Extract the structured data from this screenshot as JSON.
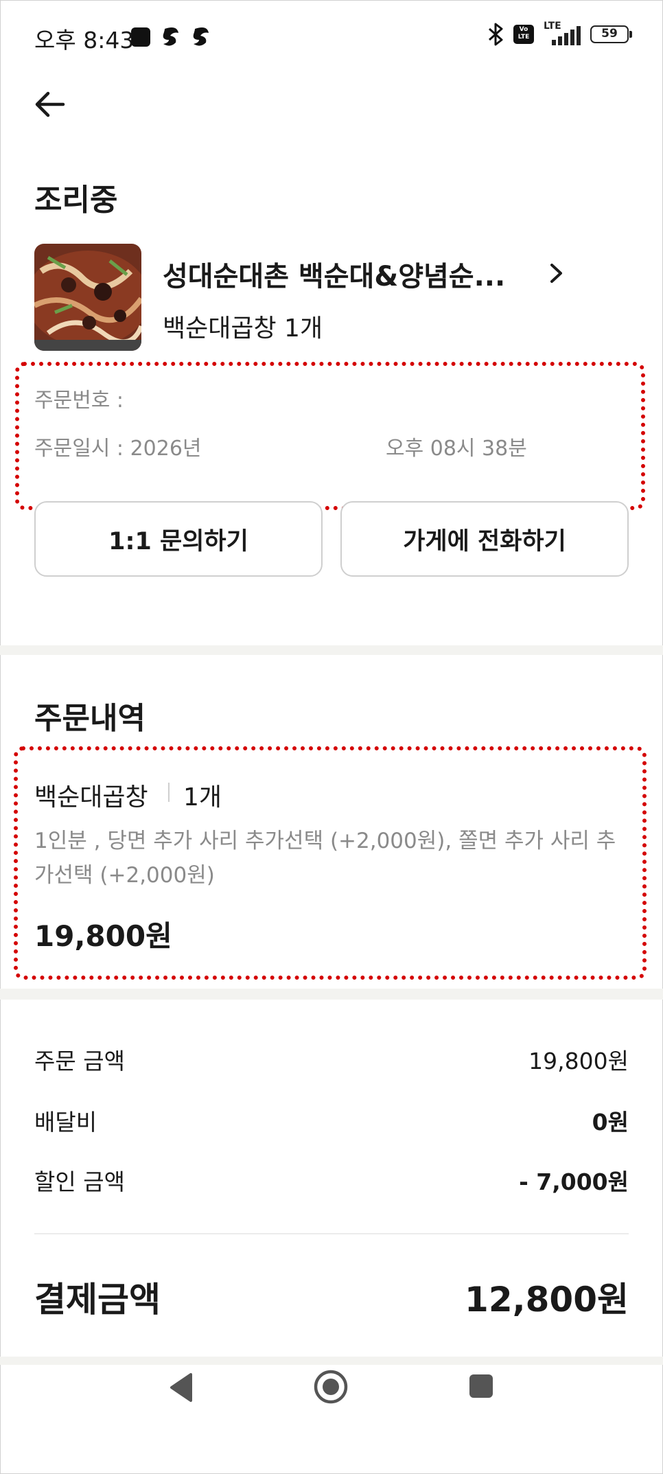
{
  "status_bar": {
    "time": "오후 8:43",
    "volte": "Vo LTE",
    "network": "LTE",
    "battery": "59"
  },
  "page": {
    "status_title": "조리중"
  },
  "store": {
    "name": "성대순대촌 백순대&양념순...",
    "items_summary": "백순대곱창 1개"
  },
  "order_info": {
    "number_label": "주문번호 :",
    "date_label": "주문일시 : 2026년",
    "time_text": "오후 08시 38분"
  },
  "buttons": {
    "inquiry": "1:1 문의하기",
    "call_store": "가게에 전화하기"
  },
  "order_details": {
    "title": "주문내역",
    "item_name": "백순대곱창",
    "item_qty": "1개",
    "item_options": "1인분 , 당면 추가 사리 추가선택 (+2,000원), 쫄면 추가 사리 추가선택 (+2,000원)",
    "item_price": "19,800원"
  },
  "summary": {
    "rows": [
      {
        "label": "주문 금액",
        "value": "19,800원"
      },
      {
        "label": "배달비",
        "value": "0원"
      },
      {
        "label": "할인 금액",
        "value": "- 7,000원"
      }
    ],
    "total_label": "결제금액",
    "total_value": "12,800원"
  },
  "colors": {
    "annotation_red": "#d40000",
    "divider": "#f3f3f0",
    "muted_text": "#8a8a8a"
  },
  "icons": [
    "back-arrow-icon",
    "chevron-right-icon",
    "bluetooth-icon",
    "nav-back-icon",
    "nav-home-icon",
    "nav-recents-icon"
  ]
}
